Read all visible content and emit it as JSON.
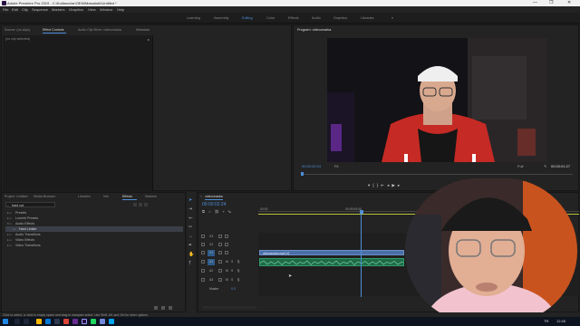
{
  "window": {
    "title": "Adobe Premiere Pro 2019 - C:\\Kullanıcılar\\OEM\\Masaüstü\\Untitled *",
    "controls": [
      "—",
      "❐",
      "✕"
    ]
  },
  "menu": [
    "File",
    "Edit",
    "Clip",
    "Sequence",
    "Markers",
    "Graphics",
    "View",
    "Window",
    "Help"
  ],
  "workspaces": {
    "items": [
      "Learning",
      "Assembly",
      "Editing",
      "Color",
      "Effects",
      "Audio",
      "Graphics",
      "Libraries"
    ],
    "active": "Editing",
    "more": "»"
  },
  "source_panel": {
    "tabs": [
      "Source: (no clips)",
      "Effect Controls",
      "Audio Clip Mixer: videoonarka",
      "Metadata"
    ],
    "active_tab": "Effect Controls",
    "body_text": "(no clip selected)"
  },
  "program_panel": {
    "title": "Program: videoonarka",
    "timecode": "00:00:02:24",
    "fit": "Fit",
    "quality": "Full",
    "duration": "00:00:01:27"
  },
  "project_panel": {
    "tabs": [
      "Project: Untitled",
      "Media Browser",
      "Libraries",
      "Info",
      "Effects",
      "Markers"
    ],
    "active_tab": "Effects",
    "search_value": "hard cut",
    "tree": [
      {
        "label": "Presets",
        "indent": 0
      },
      {
        "label": "Lumetri Presets",
        "indent": 0
      },
      {
        "label": "Audio Effects",
        "indent": 0
      },
      {
        "label": "Hard Limiter",
        "indent": 1,
        "selected": true
      },
      {
        "label": "Audio Transitions",
        "indent": 0
      },
      {
        "label": "Video Effects",
        "indent": 0
      },
      {
        "label": "Video Transitions",
        "indent": 0
      }
    ]
  },
  "timeline_panel": {
    "tab": "videoonarka",
    "timecode": "00:00:02:24",
    "ruler": [
      "00:00",
      "00:00:05:00"
    ],
    "tracks": [
      {
        "name": "V3"
      },
      {
        "name": "V2"
      },
      {
        "name": "V1"
      },
      {
        "name": "A1"
      },
      {
        "name": "A2"
      },
      {
        "name": "A3"
      }
    ],
    "master": {
      "label": "Master",
      "value": "0.0"
    },
    "clip_label": "videoonarka.mp4 [V]",
    "playhead_fraction": 0.32
  },
  "status_bar": "Click to select, or click in empty space and drag to marquee select. Use Shift, Alt, and Ctrl for other options.",
  "taskbar": {
    "time": "12:45",
    "lang": "TR"
  },
  "colors": {
    "accent": "#4f8ed9",
    "audio_wave": "#2f9c6a",
    "video_clip": "#4a6fa8",
    "selected_track": "#2e5b8a"
  }
}
